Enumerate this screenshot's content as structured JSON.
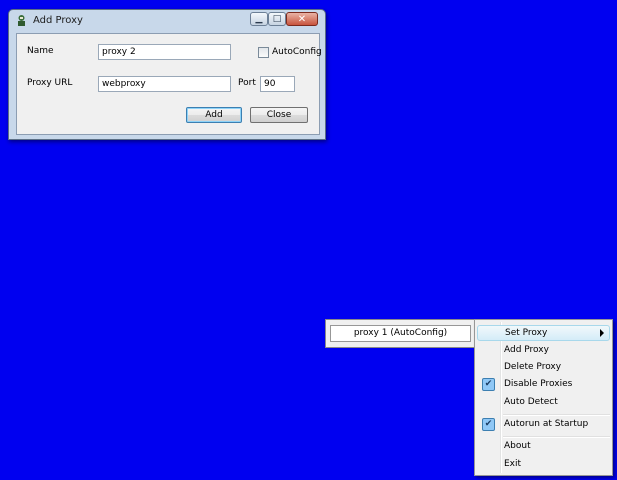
{
  "window": {
    "title": "Add Proxy",
    "minimize_glyph": "▁",
    "maximize_glyph": "□",
    "close_glyph": "✕",
    "form": {
      "name_label": "Name",
      "name_value": "proxy 2",
      "autoconfig_label": "AutoConfig",
      "autoconfig_checked": false,
      "url_label": "Proxy URL",
      "url_value": "webproxy",
      "port_label": "Port",
      "port_value": "90"
    },
    "add_label": "Add",
    "close_label": "Close"
  },
  "tray": {
    "current_proxy": "proxy 1 (AutoConfig)"
  },
  "menu": {
    "items": [
      {
        "label": "Set Proxy",
        "submenu": true,
        "highlighted": true
      },
      {
        "label": "Add Proxy"
      },
      {
        "label": "Delete Proxy"
      },
      {
        "label": "Disable Proxies",
        "checked": true
      },
      {
        "label": "Auto Detect"
      },
      {
        "label": "Autorun at Startup",
        "checked": true
      },
      {
        "label": "About"
      },
      {
        "label": "Exit"
      }
    ],
    "check_glyph": "✔"
  },
  "colors": {
    "desktop": "#0000f0",
    "window_frame": "#c8d8ea",
    "menu_highlight": "#d4ecf8",
    "check_bg": "#90c8f6"
  }
}
